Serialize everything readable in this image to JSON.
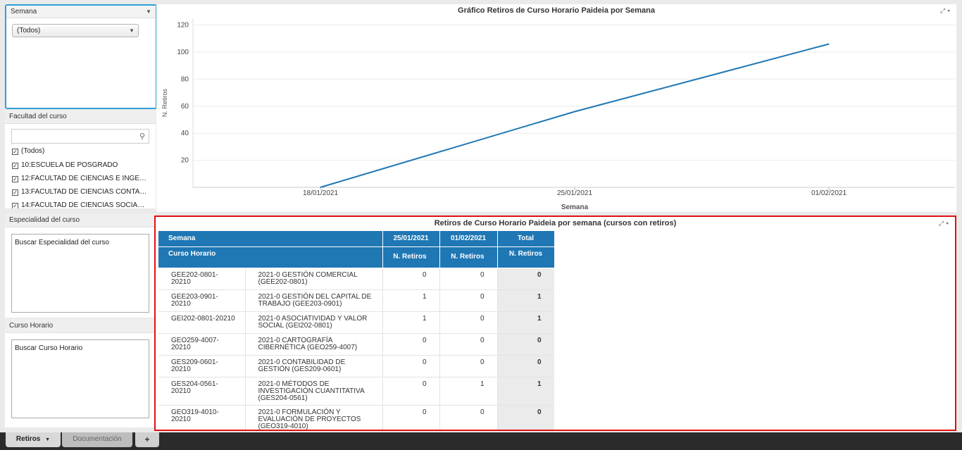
{
  "filters": {
    "semana": {
      "title": "Semana",
      "selected": "(Todos)"
    },
    "facultad": {
      "title": "Facultad del curso",
      "items": [
        "(Todos)",
        "10:ESCUELA DE POSGRADO",
        "12:FACULTAD DE CIENCIAS E INGE…",
        "13:FACULTAD DE CIENCIAS CONTA…",
        "14:FACULTAD DE CIENCIAS SOCIA…"
      ]
    },
    "especialidad": {
      "title": "Especialidad del curso",
      "placeholder": "Buscar Especialidad del curso"
    },
    "curso": {
      "title": "Curso Horario",
      "placeholder": "Buscar Curso Horario"
    }
  },
  "chart_data": {
    "type": "line",
    "title": "Gráfico Retiros de Curso Horario Paideia por Semana",
    "xlabel": "Semana",
    "ylabel": "N. Retiros",
    "categories": [
      "18/01/2021",
      "25/01/2021",
      "01/02/2021"
    ],
    "values": [
      0,
      56,
      106
    ],
    "yticks": [
      20,
      40,
      60,
      80,
      100,
      120
    ],
    "ylim": [
      0,
      125
    ],
    "color": "#1f77b4"
  },
  "table": {
    "title": "Retiros de Curso Horario Paideia por semana (cursos con retiros)",
    "h_semana": "Semana",
    "h_curso": "Curso Horario",
    "weeks": [
      "25/01/2021",
      "01/02/2021"
    ],
    "h_total": "Total",
    "h_metric": "N. Retiros",
    "rows": [
      {
        "code": "GEE202-0801-20210",
        "name": "2021-0 GESTIÓN COMERCIAL (GEE202-0801)",
        "w1": "0",
        "w2": "0",
        "total": "0"
      },
      {
        "code": "GEE203-0901-20210",
        "name": "2021-0 GESTIÓN DEL CAPITAL DE TRABAJO (GEE203-0901)",
        "w1": "1",
        "w2": "0",
        "total": "1"
      },
      {
        "code": "GEI202-0801-20210",
        "name": "2021-0 ASOCIATIVIDAD Y VALOR SOCIAL (GEI202-0801)",
        "w1": "1",
        "w2": "0",
        "total": "1"
      },
      {
        "code": "GEO259-4007-20210",
        "name": "2021-0 CARTOGRAFÍA CIBERNÉTICA (GEO259-4007)",
        "w1": "0",
        "w2": "0",
        "total": "0"
      },
      {
        "code": "GES209-0601-20210",
        "name": "2021-0 CONTABILIDAD DE GESTIÓN (GES209-0601)",
        "w1": "0",
        "w2": "0",
        "total": "0"
      },
      {
        "code": "GES204-0561-20210",
        "name": "2021-0 MÉTODOS DE INVESTIGACIÓN CUANTITATIVA (GES204-0561)",
        "w1": "0",
        "w2": "1",
        "total": "1"
      },
      {
        "code": "GEO319-4010-20210",
        "name": "2021-0 FORMULACIÓN Y EVALUACIÓN DE PROYECTOS (GEO319-4010)",
        "w1": "0",
        "w2": "0",
        "total": "0"
      }
    ]
  },
  "sheets": {
    "active": "Retiros",
    "other": "Documentación",
    "add": "+"
  }
}
